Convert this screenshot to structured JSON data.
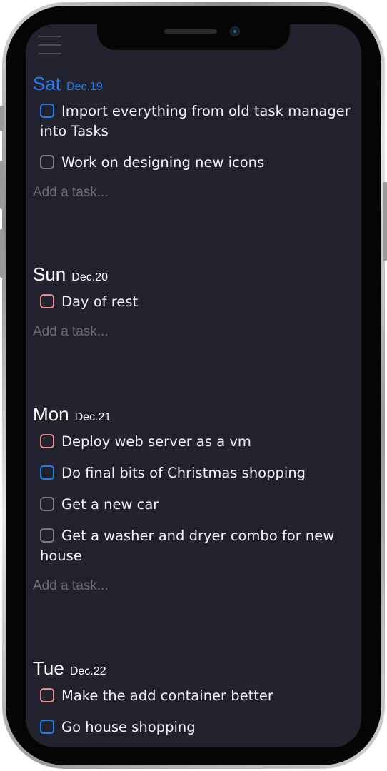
{
  "header": {
    "menu_icon": "hamburger-menu-icon"
  },
  "colors": {
    "background": "#21222e",
    "today_accent": "#1f7ff0",
    "checkbox_blue": "#1f7ff0",
    "checkbox_red": "#e58a8a",
    "checkbox_gray": "#7d7d7d",
    "placeholder": "#6e6f7a"
  },
  "days": [
    {
      "name": "Sat",
      "date": "Dec.19",
      "is_today": true,
      "tasks": [
        {
          "text": "Import everything from old task manager into Tasks",
          "priority": "blue"
        },
        {
          "text": "Work on designing new icons",
          "priority": "gray"
        }
      ],
      "add_placeholder": "Add a task..."
    },
    {
      "name": "Sun",
      "date": "Dec.20",
      "is_today": false,
      "tasks": [
        {
          "text": "Day of rest",
          "priority": "red"
        }
      ],
      "add_placeholder": "Add a task..."
    },
    {
      "name": "Mon",
      "date": "Dec.21",
      "is_today": false,
      "tasks": [
        {
          "text": "Deploy web server as a vm",
          "priority": "red"
        },
        {
          "text": "Do final bits of Christmas shopping",
          "priority": "blue"
        },
        {
          "text": "Get a new car",
          "priority": "gray"
        },
        {
          "text": "Get a washer and dryer combo for new house",
          "priority": "gray"
        }
      ],
      "add_placeholder": "Add a task..."
    },
    {
      "name": "Tue",
      "date": "Dec.22",
      "is_today": false,
      "tasks": [
        {
          "text": "Make the add container better",
          "priority": "red"
        },
        {
          "text": "Go house shopping",
          "priority": "blue"
        }
      ]
    }
  ]
}
